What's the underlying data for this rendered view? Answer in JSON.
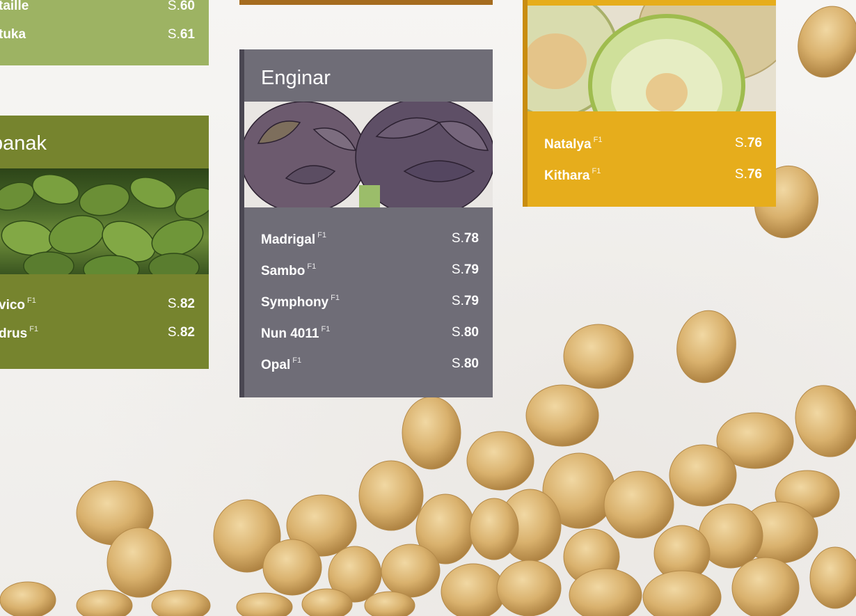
{
  "salad": {
    "rows": [
      {
        "name": "taille",
        "pre": "S.",
        "page": "60"
      },
      {
        "name": "tuka",
        "pre": "S.",
        "page": "61"
      }
    ]
  },
  "spinach": {
    "title": "panak",
    "rows": [
      {
        "name": "vico",
        "sup": "F1",
        "pre": "S.",
        "page": "82"
      },
      {
        "name": "drus",
        "sup": "F1",
        "pre": "S.",
        "page": "82"
      }
    ]
  },
  "artichoke": {
    "title": "Enginar",
    "rows": [
      {
        "name": "Madrigal",
        "sup": "F1",
        "pre": "S.",
        "page": "78"
      },
      {
        "name": "Sambo",
        "sup": "F1",
        "pre": "S.",
        "page": "79"
      },
      {
        "name": "Symphony",
        "sup": "F1",
        "pre": "S.",
        "page": "79"
      },
      {
        "name": "Nun 4011",
        "sup": "F1",
        "pre": "S.",
        "page": "80"
      },
      {
        "name": "Opal",
        "sup": "F1",
        "pre": "S.",
        "page": "80"
      }
    ]
  },
  "melon": {
    "rows": [
      {
        "name": "Natalya",
        "sup": "F1",
        "pre": "S.",
        "page": "76"
      },
      {
        "name": "Kithara",
        "sup": "F1",
        "pre": "S.",
        "page": "76"
      }
    ]
  },
  "colors": {
    "salad": "#9db363",
    "spinach": "#76842e",
    "artichoke": "#6f6d77",
    "melon": "#e6ad1c",
    "accent_brown": "#a56c1f"
  }
}
